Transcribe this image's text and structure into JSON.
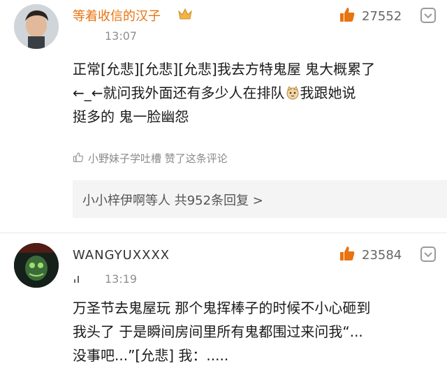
{
  "comments": [
    {
      "username": "等着收信的汉子",
      "time": "13:07",
      "likes": "27552",
      "text_line1": "正常[允悲][允悲][允悲]我去方特鬼屋 鬼大概累了",
      "text_line2_a": "←_←就问我外面还有多少人在排队",
      "text_line2_b": "我跟她说",
      "text_line3": "挺多的 鬼一脸幽怨",
      "liked_by": "小野妹子学吐槽 赞了这条评论",
      "replies_summary": "小小梓伊啊等人 共952条回复 >"
    },
    {
      "username": "WANGYUXXXX",
      "time": "13:19",
      "likes": "23584",
      "text_line1": "万圣节去鬼屋玩 那个鬼挥棒子的时候不小心砸到",
      "text_line2": "我头了 于是瞬间房间里所有鬼都围过来问我“...",
      "text_line3": "没事吧...”[允悲] 我：....."
    }
  ],
  "colors": {
    "accent": "#e8730f",
    "like": "#e8730f",
    "reply_bg": "#f4f4f4"
  }
}
